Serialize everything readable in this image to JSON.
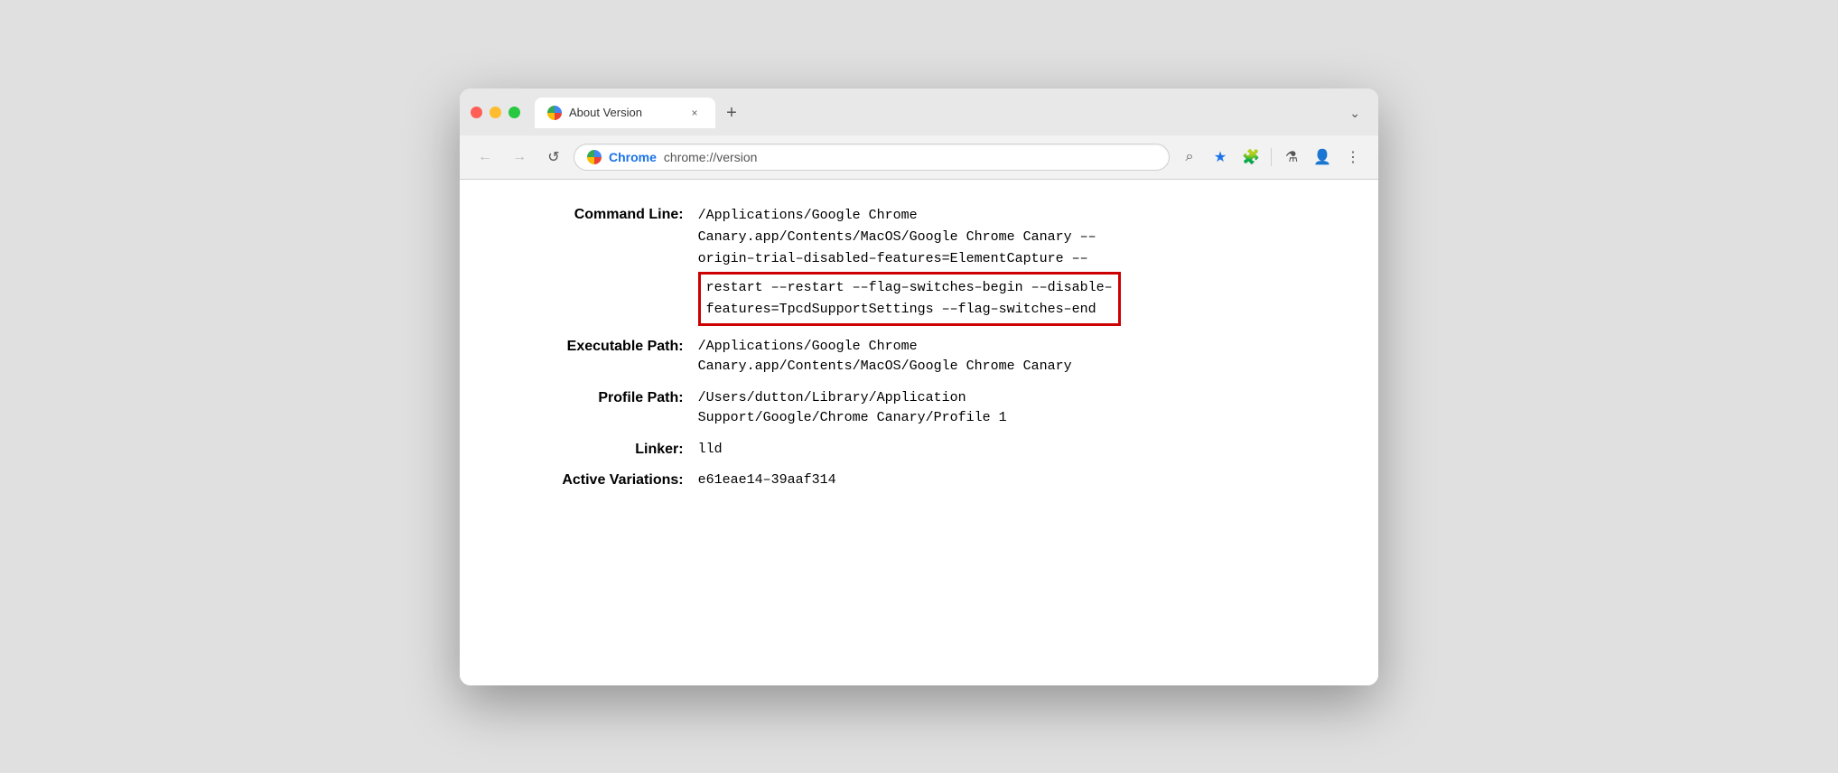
{
  "window": {
    "tab_title": "About Version",
    "tab_close_label": "×",
    "tab_new_label": "+",
    "tab_list_label": "⌄"
  },
  "nav": {
    "back_label": "←",
    "forward_label": "→",
    "refresh_label": "↺",
    "address_brand": "Chrome",
    "address_url": "chrome://version",
    "search_label": "⌕",
    "bookmark_label": "★",
    "extensions_label": "🧩",
    "lab_label": "⚗",
    "profile_label": "👤",
    "menu_label": "⋮"
  },
  "content": {
    "command_line_label": "Command Line:",
    "command_line_line1": "/Applications/Google Chrome",
    "command_line_line2": "Canary.app/Contents/MacOS/Google Chrome Canary ––",
    "command_line_line3": "origin–trial–disabled–features=ElementCapture ––",
    "command_line_highlighted1": "restart ––restart ––flag–switches–begin ––disable–",
    "command_line_highlighted2": "features=TpcdSupportSettings ––flag–switches–end",
    "executable_path_label": "Executable Path:",
    "executable_path_line1": "/Applications/Google Chrome",
    "executable_path_line2": "Canary.app/Contents/MacOS/Google Chrome Canary",
    "profile_path_label": "Profile Path:",
    "profile_path_line1": "/Users/dutton/Library/Application",
    "profile_path_line2": "Support/Google/Chrome Canary/Profile 1",
    "linker_label": "Linker:",
    "linker_value": "lld",
    "active_variations_label": "Active Variations:",
    "active_variations_value": "e61eae14–39aaf314"
  },
  "colors": {
    "highlight_border": "#cc0000",
    "star_color": "#1a73e8"
  }
}
